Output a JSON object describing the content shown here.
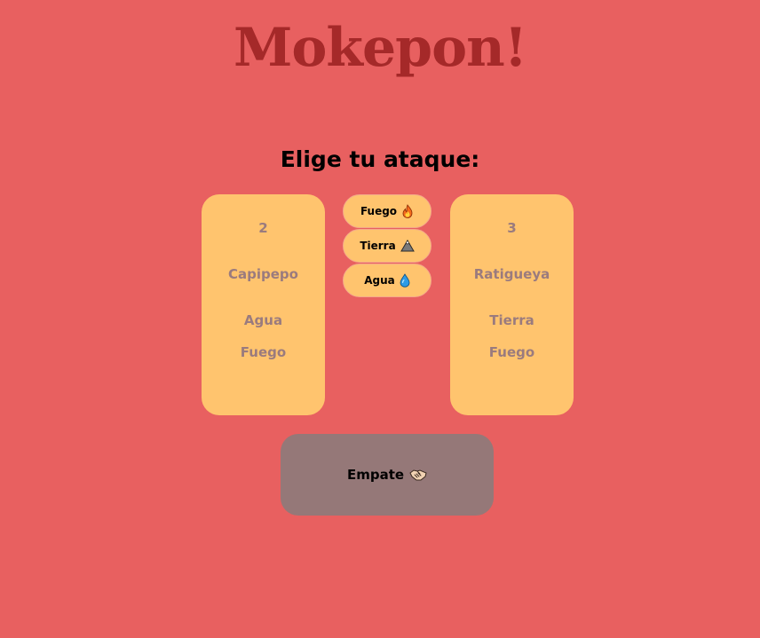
{
  "title": "Mokepon!",
  "subtitle": "Elige tu ataque:",
  "player_card": {
    "lives": "2",
    "name": "Capipepo",
    "attacks": [
      "Agua",
      "Fuego"
    ]
  },
  "enemy_card": {
    "lives": "3",
    "name": "Ratigueya",
    "attacks": [
      "Tierra",
      "Fuego"
    ]
  },
  "attack_buttons": {
    "fuego": {
      "label": "Fuego",
      "icon": "fire-icon"
    },
    "tierra": {
      "label": "Tierra",
      "icon": "mountain-icon"
    },
    "agua": {
      "label": "Agua",
      "icon": "water-drop-icon"
    }
  },
  "result": {
    "label": "Empate",
    "icon": "handshake-icon"
  },
  "colors": {
    "background": "#e86060",
    "title": "#a52929",
    "card": "#ffc46e",
    "card_text": "#9a7b7e",
    "result_box": "#957878"
  }
}
